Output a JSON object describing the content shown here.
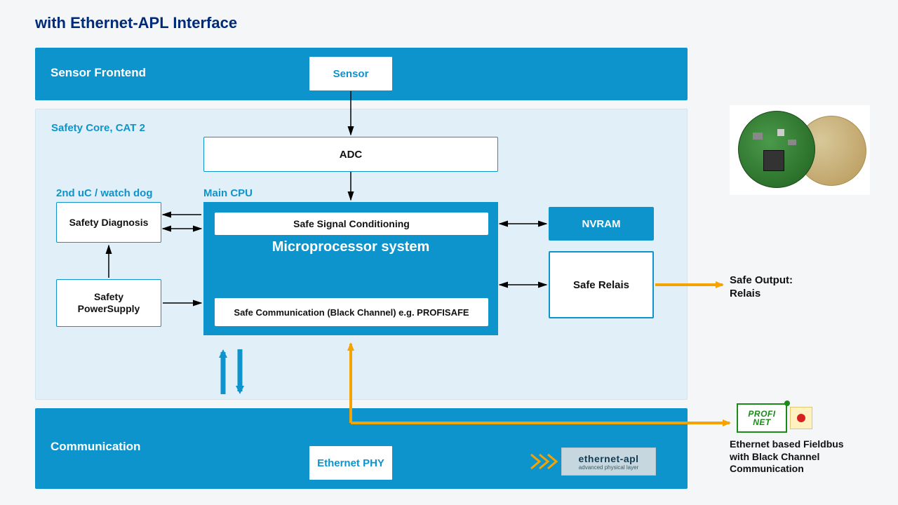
{
  "title": "with Ethernet-APL Interface",
  "panels": {
    "sensorFrontend": "Sensor Frontend",
    "safetyCore": "Safety Core, CAT 2",
    "communication": "Communication"
  },
  "labels": {
    "watchdog": "2nd uC / watch dog",
    "mainCpu": "Main CPU"
  },
  "boxes": {
    "sensor": "Sensor",
    "adc": "ADC",
    "safetyDiagnosis": "Safety Diagnosis",
    "safetyPower": "Safety PowerSupply",
    "safeSignal": "Safe Signal Conditioning",
    "microprocessor": "Microprocessor system",
    "safeComm": "Safe Communication (Black Channel) e.g. PROFISAFE",
    "nvram": "NVRAM",
    "safeRelais": "Safe Relais",
    "ethernetPhy": "Ethernet PHY"
  },
  "sideText": {
    "safeOutput1": "Safe Output:",
    "safeOutput2": "Relais",
    "fieldbus1": "Ethernet based Fieldbus",
    "fieldbus2": "with Black Channel",
    "fieldbus3": "Communication"
  },
  "logos": {
    "aplLine1": "ethernet-apl",
    "aplLine2": "advanced physical layer",
    "profinet1": "PROFI",
    "profinet2": "NET"
  }
}
